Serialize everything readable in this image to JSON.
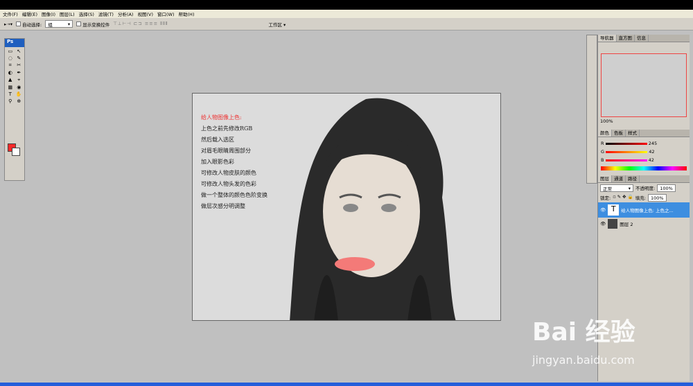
{
  "menu": [
    "文件(F)",
    "编辑(E)",
    "图像(I)",
    "图层(L)",
    "选择(S)",
    "滤镜(T)",
    "分析(A)",
    "视图(V)",
    "窗口(W)",
    "帮助(H)"
  ],
  "options": {
    "auto_select": "自动选择:",
    "auto_select_value": "组",
    "transform": "显示变换控件",
    "workspace": "工作区"
  },
  "tools": {
    "header": "Ps",
    "items": [
      "▭",
      "↖",
      "◌",
      "✎",
      "⌗",
      "✂",
      "◐",
      "✒",
      "▲",
      "⌖",
      "▦",
      "◉",
      "T",
      "✋",
      "⚲",
      "⊕"
    ]
  },
  "canvas": {
    "notes": [
      "给人物图像上色:",
      "上色之前先修改RGB",
      "然后载入选区",
      "对眉毛眼睛周围部分",
      "加入眼影色彩",
      "可修改人物皮肤的颜色",
      "可修改人物头发的色彩",
      "做一个整体的颜色色阶变换",
      "做层次感分明调整"
    ]
  },
  "navigator": {
    "tabs": [
      "导航器",
      "直方图",
      "信息"
    ],
    "zoom": "100%"
  },
  "color": {
    "tabs": [
      "颜色",
      "色板",
      "样式"
    ],
    "R": "245",
    "G": "42",
    "B": "42",
    "r_label": "R",
    "g_label": "G",
    "b_label": "B"
  },
  "layers": {
    "tabs": [
      "图层",
      "通道",
      "路径"
    ],
    "mode": "正常",
    "opacity_label": "不透明度:",
    "opacity": "100%",
    "lock_label": "锁定:",
    "fill_label": "填充:",
    "fill": "100%",
    "rows": [
      {
        "thumb": "T",
        "name": "给人物图像上色: 上色之..."
      },
      {
        "thumb": "",
        "name": "图层 2"
      }
    ]
  },
  "watermark": {
    "brand": "Bai 经验",
    "url": "jingyan.baidu.com"
  },
  "colors": {
    "accent": "#3d8ee0",
    "fg": "#f52a2a"
  }
}
